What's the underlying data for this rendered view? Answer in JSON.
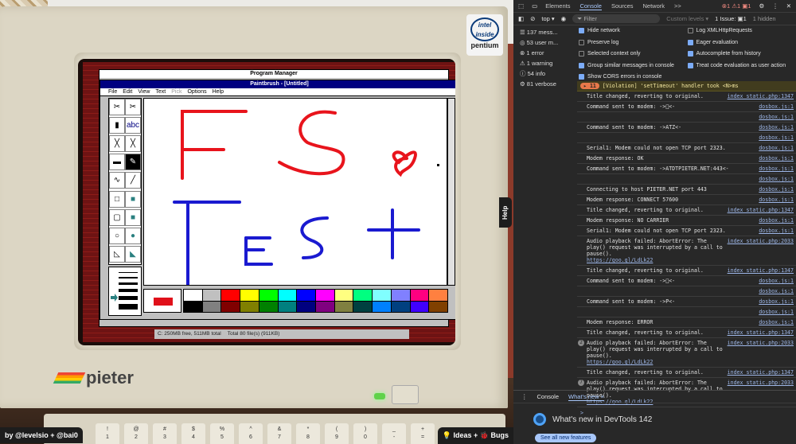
{
  "scene": {
    "program_manager_title": "Program Manager",
    "paintbrush_title": "Paintbrush - [Untitled]",
    "menu": [
      "File",
      "Edit",
      "View",
      "Text",
      "Pick",
      "Options",
      "Help"
    ],
    "menu_disabled": [
      false,
      false,
      false,
      false,
      true,
      false,
      false
    ],
    "tools": [
      "scissors-pick",
      "scissors",
      "airbrush",
      "abc",
      "color-eraser",
      "eraser",
      "paint-roller",
      "brush",
      "curve",
      "line",
      "box",
      "filled-box",
      "rounded-box",
      "filled-rounded-box",
      "circle",
      "filled-circle",
      "polygon",
      "filled-polygon"
    ],
    "tool_glyphs": [
      "✂",
      "✂",
      "▮",
      "abc",
      "╳",
      "╳",
      "▬",
      "✎",
      "∿",
      "╱",
      "□",
      "■",
      "▢",
      "■",
      "○",
      "●",
      "◺",
      "◣"
    ],
    "palette_colors": [
      "#ffffff",
      "#c0c0c0",
      "#ff0000",
      "#ffff00",
      "#00ff00",
      "#00ffff",
      "#0000ff",
      "#ff00ff",
      "#ffff80",
      "#00ff80",
      "#80ffff",
      "#8080ff",
      "#ff0080",
      "#ff8040",
      "#000000",
      "#808080",
      "#800000",
      "#808000",
      "#008000",
      "#008080",
      "#000080",
      "#800080",
      "#808040",
      "#004040",
      "#0080ff",
      "#004080",
      "#4000ff",
      "#804000"
    ],
    "foreground_color": "#e0101a",
    "status_left": "C: 250MB free, 511MB total",
    "status_right": "Total 80 file(s) (911KB)",
    "intel_line1": "intel",
    "intel_line2": "inside",
    "intel_line3": "pentium",
    "brand": "pieter",
    "keys": [
      [
        "!",
        "1"
      ],
      [
        "@",
        "2"
      ],
      [
        "#",
        "3"
      ],
      [
        "$",
        "4"
      ],
      [
        "%",
        "5"
      ],
      [
        "^",
        "6"
      ],
      [
        "&",
        "7"
      ],
      [
        "*",
        "8"
      ],
      [
        "(",
        "9"
      ],
      [
        ")",
        "0"
      ],
      [
        "_",
        "-"
      ],
      [
        "+",
        "="
      ]
    ],
    "credit": "by @levelsio + @bai0",
    "ideas": "💡 Ideas + 🐞 Bugs",
    "help": "Help"
  },
  "devtools": {
    "tabs": [
      "Elements",
      "Console",
      "Sources",
      "Network",
      ">>"
    ],
    "active_tab": "Console",
    "counts": "⊗1 ⚠1 ▣1",
    "context": "top ▾",
    "filter_placeholder": "Filter",
    "levels": "Custom levels ▾",
    "issues": "1 Issue: ▣1",
    "hidden": "1 hidden",
    "sidebar": [
      "☰ 137 mess...",
      "◎ 53 user m...",
      "⊗ 1 error",
      "⚠ 1 warning",
      "ⓘ 54 info",
      "⚙ 81 verbose"
    ],
    "settings": [
      {
        "label": "Hide network",
        "on": true
      },
      {
        "label": "Log XMLHttpRequests",
        "on": false
      },
      {
        "label": "Preserve log",
        "on": false
      },
      {
        "label": "Eager evaluation",
        "on": true
      },
      {
        "label": "Selected context only",
        "on": false
      },
      {
        "label": "Autocomplete from history",
        "on": true
      },
      {
        "label": "Group similar messages in console",
        "on": true
      },
      {
        "label": "Treat code evaluation as user action",
        "on": true
      },
      {
        "label": "Show CORS errors in console",
        "on": true
      }
    ],
    "violation_count": "▸ 11",
    "violation": "[Violation] 'setTimeout' handler took <N>ms",
    "messages": [
      {
        "count": "",
        "text": "Title changed, reverting to original.",
        "src": "index_static.php:1347"
      },
      {
        "count": "",
        "text": "Command sent to modem: ->\u0000<-",
        "src": "dosbox.js:1"
      },
      {
        "count": "",
        "text": "",
        "src": "dosbox.js:1"
      },
      {
        "count": "",
        "text": "Command sent to modem: ->ATZ<-",
        "src": "dosbox.js:1"
      },
      {
        "count": "",
        "text": "",
        "src": "dosbox.js:1"
      },
      {
        "count": "",
        "text": "Serial1: Modem could not open TCP port 2323.",
        "src": "dosbox.js:1"
      },
      {
        "count": "",
        "text": "Modem response: OK",
        "src": "dosbox.js:1"
      },
      {
        "count": "",
        "text": "Command sent to modem: ->ATDTPIETER.NET:443<-",
        "src": "dosbox.js:1"
      },
      {
        "count": "",
        "text": "",
        "src": "dosbox.js:1"
      },
      {
        "count": "",
        "text": "Connecting to host PIETER.NET port 443",
        "src": "dosbox.js:1"
      },
      {
        "count": "",
        "text": "Modem response: CONNECT 57600",
        "src": "dosbox.js:1"
      },
      {
        "count": "",
        "text": "Title changed, reverting to original.",
        "src": "index_static.php:1347"
      },
      {
        "count": "",
        "text": "Modem response: NO CARRIER",
        "src": "dosbox.js:1"
      },
      {
        "count": "",
        "text": "Serial1: Modem could not open TCP port 2323.",
        "src": "dosbox.js:1"
      },
      {
        "count": "",
        "text": "Audio playback failed: AbortError: The play() request was interrupted by a call to pause().",
        "link": "https://goo.gl/LdLk22",
        "src": "index_static.php:2033"
      },
      {
        "count": "",
        "text": "Title changed, reverting to original.",
        "src": "index_static.php:1347"
      },
      {
        "count": "",
        "text": "Command sent to modem: ->\u0000<-",
        "src": "dosbox.js:1"
      },
      {
        "count": "",
        "text": "",
        "src": "dosbox.js:1"
      },
      {
        "count": "",
        "text": "Command sent to modem: ->P<-",
        "src": "dosbox.js:1"
      },
      {
        "count": "",
        "text": "",
        "src": "dosbox.js:1"
      },
      {
        "count": "",
        "text": "Modem response: ERROR",
        "src": "dosbox.js:1"
      },
      {
        "count": "",
        "text": "Title changed, reverting to original.",
        "src": "index_static.php:1347"
      },
      {
        "count": "2",
        "text": "Audio playback failed: AbortError: The play() request was interrupted by a call to pause().",
        "link": "https://goo.gl/LdLk22",
        "src": "index_static.php:2033"
      },
      {
        "count": "",
        "text": "Title changed, reverting to original.",
        "src": "index_static.php:1347"
      },
      {
        "count": "7",
        "text": "Audio playback failed: AbortError: The play() request was interrupted by a call to pause().",
        "link": "https://goo.gl/LdLk22",
        "src": "index_static.php:2033"
      }
    ],
    "prompt": ">",
    "drawer_tabs": [
      "Console",
      "What's new ×"
    ],
    "whats_new_title": "What's new in DevTools 142",
    "see_all": "See all new features"
  }
}
